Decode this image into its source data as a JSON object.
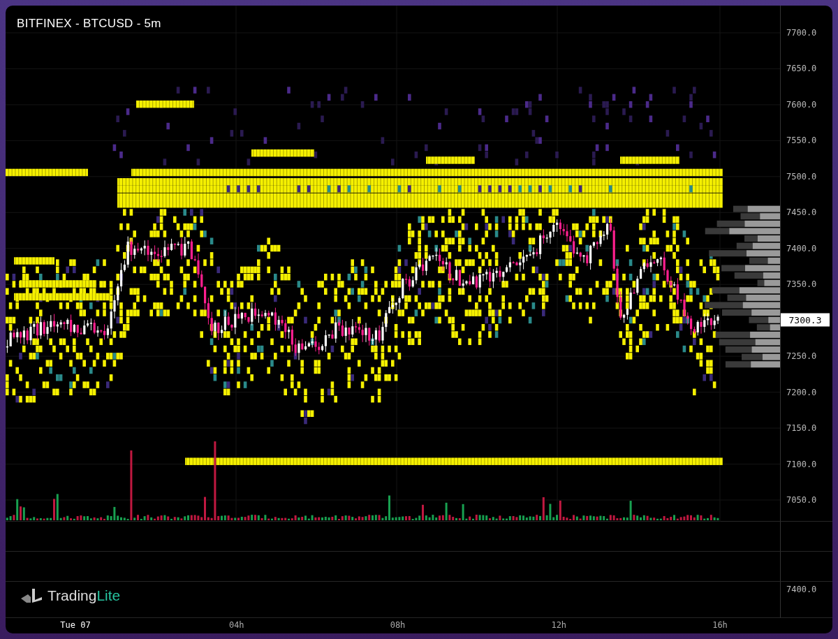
{
  "chart": {
    "title": "BITFINEX - BTCUSD - 5m"
  },
  "price_axis": {
    "ticks": [
      "7700.0",
      "7650.0",
      "7600.0",
      "7550.0",
      "7500.0",
      "7450.0",
      "7400.0",
      "7350.0",
      "7250.0",
      "7200.0",
      "7150.0",
      "7100.0",
      "7050.0"
    ],
    "current_price": "7300.3"
  },
  "indicator_pane": {
    "axis_label": "7400.0"
  },
  "time_axis": {
    "ticks": [
      "Tue 07",
      "04h",
      "08h",
      "12h",
      "16h"
    ]
  },
  "logo": {
    "name": "Trading",
    "accent": "Lite"
  }
}
